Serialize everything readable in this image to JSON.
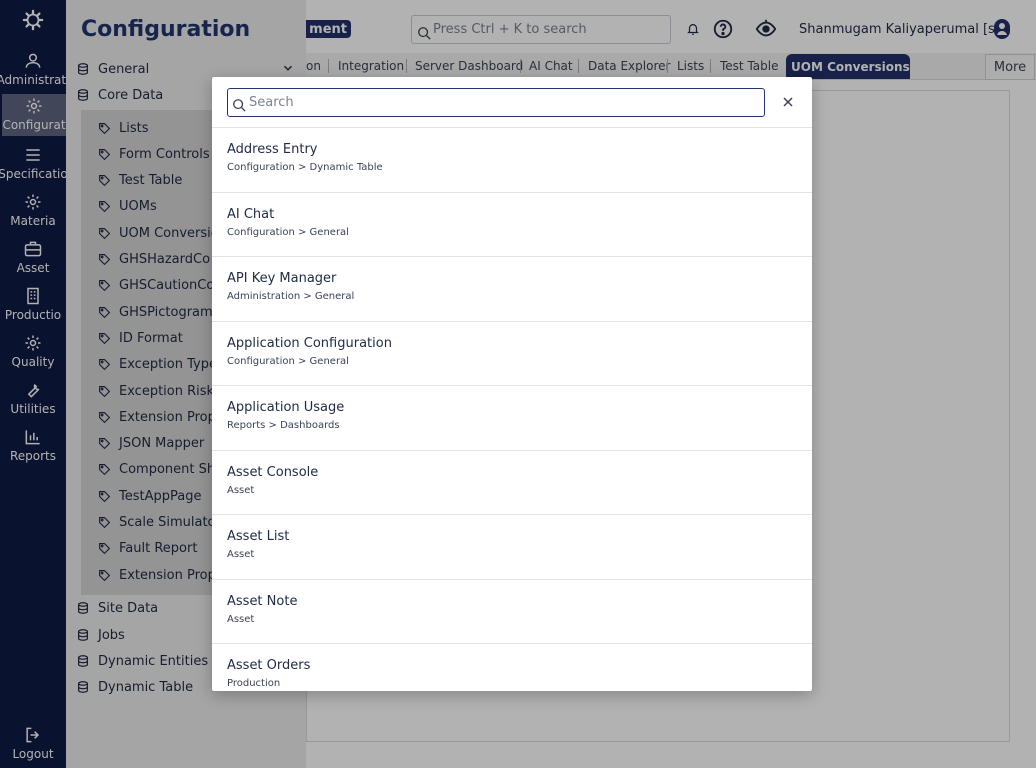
{
  "rail": {
    "items": [
      {
        "label": "Administrati",
        "icon": "users-icon"
      },
      {
        "label": "Configurat",
        "icon": "gear-icon",
        "active": true
      },
      {
        "label": "Specificatio",
        "icon": "list-icon"
      },
      {
        "label": "Materia",
        "icon": "gear-icon"
      },
      {
        "label": "Asset",
        "icon": "briefcase-icon"
      },
      {
        "label": "Productio",
        "icon": "building-icon"
      },
      {
        "label": "Quality",
        "icon": "gear-icon"
      },
      {
        "label": "Utilities",
        "icon": "wrench-icon"
      },
      {
        "label": "Reports",
        "icon": "bar-chart-icon"
      }
    ],
    "logout_label": "Logout"
  },
  "side": {
    "title": "Configuration",
    "groups": [
      "General",
      "Core Data"
    ],
    "sub_items": [
      "Lists",
      "Form Controls",
      "Test Table",
      "UOMs",
      "UOM Conversio",
      "GHSHazardCo",
      "GHSCautionCo",
      "GHSPictogram",
      "ID Format",
      "Exception Type",
      "Exception Risk T",
      "Extension Prope",
      "JSON Mapper",
      "Component Sh",
      "TestAppPage",
      "Scale Simulato",
      "Fault Report",
      "Extension Prope"
    ],
    "bottom_groups": [
      "Site Data",
      "Jobs",
      "Dynamic Entities",
      "Dynamic Table"
    ]
  },
  "header": {
    "env_badge": "ment",
    "search_placeholder": "Press Ctrl + K to search",
    "user_name": "Shanmugam Kaliyaperumal [sk]"
  },
  "tabs": {
    "items": [
      "on",
      "Integration",
      "Server Dashboard",
      "AI Chat",
      "Data Explorer",
      "Lists",
      "Test Table"
    ],
    "active": "UOM Conversions",
    "more": "More"
  },
  "modal": {
    "search_placeholder": "Search",
    "search_value": "",
    "results": [
      {
        "title": "Address Entry",
        "path": "Configuration > Dynamic Table"
      },
      {
        "title": "AI Chat",
        "path": "Configuration > General"
      },
      {
        "title": "API Key Manager",
        "path": "Administration > General"
      },
      {
        "title": "Application Configuration",
        "path": "Configuration > General"
      },
      {
        "title": "Application Usage",
        "path": "Reports > Dashboards"
      },
      {
        "title": "Asset Console",
        "path": "Asset"
      },
      {
        "title": "Asset List",
        "path": "Asset"
      },
      {
        "title": "Asset Note",
        "path": "Asset"
      },
      {
        "title": "Asset Orders",
        "path": "Production"
      }
    ]
  },
  "colors": {
    "rail_bg": "#0d1a43",
    "brand": "#22356f",
    "active_tab": "#21306a"
  }
}
